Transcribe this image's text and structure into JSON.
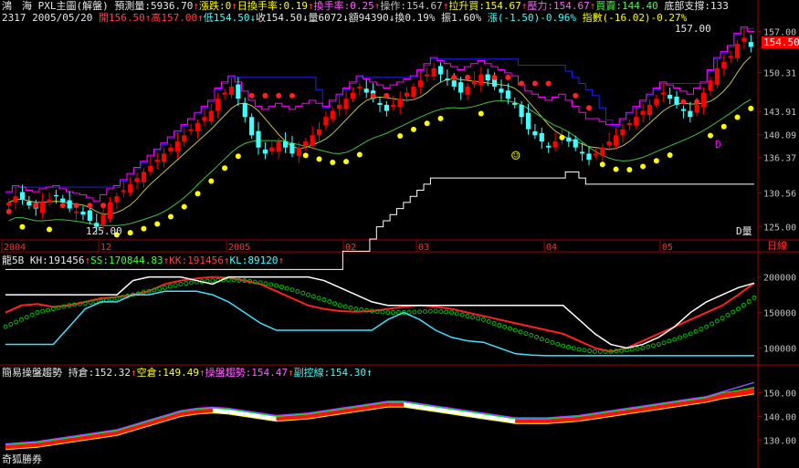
{
  "header": {
    "stock_name": "鴻　海",
    "chart_title": "PXL主圖(解盤)",
    "forecast_label": "預測量:",
    "forecast_value": "5936.70",
    "limit_down_label": "漲跌:",
    "limit_down_value": "0",
    "daily_turnover_label": "日換手率:",
    "daily_turnover_value": "0.19",
    "turnover_label": "換手率:",
    "turnover_value": "0.25",
    "operation_label": "操作:",
    "operation_value": "154.67",
    "pullup_label": "拉升買:",
    "pullup_value": "154.67",
    "pressure_label": "壓力:",
    "pressure_value": "154.67",
    "buy_label": "買賣:",
    "buy_value": "144.40",
    "support_label": "底部支撐:",
    "support_value": "133",
    "code": "2317",
    "date": "2005/05/20",
    "open_label": "開",
    "open_value": "156.50",
    "high_label": "高",
    "high_value": "157.00",
    "low_label": "低",
    "low_value": "154.50",
    "close_label": "收",
    "close_value": "154.50",
    "volume_label": "量",
    "volume_value": "6072",
    "amount_label": "額",
    "amount_value": "94390",
    "turnover2_label": "換",
    "turnover2_value": "0.19%",
    "amplitude_label": "振",
    "amplitude_value": "1.60%",
    "change_label": "漲",
    "change_value": "(-1.50)-0.96%",
    "index_label": "指數",
    "index_value": "(-16.02)-0.27%"
  },
  "colors": {
    "up": "#ff0000",
    "down": "#40ffff",
    "ma_blue": "#2020ff",
    "ma_magenta": "#ff00ff",
    "ma_green": "#40c040",
    "ma_olive": "#c0c040",
    "dot_yellow": "#ffff00",
    "dot_red": "#ff2020",
    "axis": "#a00000",
    "axis_text": "#c0c0c0",
    "date_text": "#ff3030",
    "kd_white": "#ffffff",
    "kd_green": "#00c000"
  },
  "main_panel": {
    "price_ticks": [
      "157.00",
      "150.31",
      "143.91",
      "140.09",
      "136.37",
      "130.56",
      "125.00"
    ],
    "current_price_tag": "154.50",
    "high_annotation": "157.00",
    "low_annotation": "125.00",
    "d_marker": "D",
    "volume_toggle": "D量",
    "date_labels": [
      "2004",
      "12",
      "2005",
      "02",
      "03",
      "04",
      "05"
    ],
    "period_label": "日線",
    "smiley": "☺"
  },
  "panel_kd": {
    "title": "龍5B",
    "kh_label": "KH:",
    "kh_value": "191456",
    "ss_label": "SS:",
    "ss_value": "170844.83",
    "kk_label": "KK:",
    "kk_value": "191456",
    "kl_label": "KL:",
    "kl_value": "89120",
    "ticks": [
      "200000",
      "150000",
      "100000"
    ]
  },
  "panel_trend": {
    "title": "簡易操盤趨勢",
    "hold_label": "持倉:",
    "hold_value": "152.32",
    "short_label": "空倉:",
    "short_value": "149.49",
    "trend_label": "操盤趨勢:",
    "trend_value": "154.47",
    "sub_label": "副控線:",
    "sub_value": "154.30",
    "ticks": [
      "150.00",
      "140.00",
      "130.00"
    ],
    "footer": "奇狐勝券"
  },
  "chart_data": [
    {
      "type": "candlestick",
      "title": "PXL主圖(解盤)",
      "ylim": [
        123,
        158
      ],
      "x_months": [
        "2004-11",
        "2004-12",
        "2005-01",
        "2005-02",
        "2005-03",
        "2005-04",
        "2005-05"
      ],
      "close_series": [
        129,
        130,
        129.5,
        128.5,
        128,
        129,
        129.5,
        130,
        129,
        128,
        127.5,
        127,
        126,
        125,
        127,
        129,
        130,
        131,
        132,
        133,
        134,
        135,
        136,
        137,
        138,
        139,
        140,
        141,
        142,
        143,
        144,
        146,
        147,
        148,
        146,
        143,
        140,
        138,
        137,
        138,
        139,
        138,
        137,
        138,
        139,
        140,
        141,
        143,
        144,
        145,
        146,
        147,
        148,
        147,
        146,
        145,
        144,
        145,
        146,
        147,
        148,
        149,
        150,
        151,
        150,
        149,
        148,
        147,
        148,
        149,
        150,
        149,
        148,
        147,
        146,
        145,
        143,
        141,
        140,
        139,
        138,
        139,
        140,
        139,
        138,
        137,
        136,
        137,
        138,
        139,
        140,
        141,
        142,
        143,
        144,
        145,
        146,
        147,
        146,
        145,
        144,
        143,
        145,
        147,
        149,
        151,
        152,
        153,
        155,
        156,
        154.5
      ],
      "last": {
        "open": 156.5,
        "high": 157.0,
        "low": 154.5,
        "close": 154.5
      }
    },
    {
      "type": "line",
      "title": "龍5B",
      "ylim": [
        80000,
        215000
      ],
      "series": [
        {
          "name": "KH",
          "values": [
            150000,
            160000,
            162000,
            158000,
            160000,
            165000,
            170000,
            172000,
            175000,
            180000,
            190000,
            195000,
            198000,
            200000,
            199000,
            195000,
            190000,
            180000,
            170000,
            160000,
            155000,
            152000,
            151000,
            152000,
            155000,
            158000,
            160000,
            158000,
            155000,
            150000,
            145000,
            140000,
            135000,
            130000,
            125000,
            120000,
            110000,
            100000,
            95000,
            100000,
            110000,
            120000,
            130000,
            140000,
            150000,
            160000,
            175000,
            191456
          ]
        },
        {
          "name": "SS",
          "values": [
            130000,
            140000,
            150000,
            155000,
            160000,
            163000,
            166000,
            170000,
            175000,
            180000,
            185000,
            190000,
            193000,
            195000,
            196000,
            195000,
            192000,
            188000,
            182000,
            175000,
            168000,
            160000,
            155000,
            152000,
            150000,
            150000,
            151000,
            152000,
            150000,
            145000,
            140000,
            132000,
            125000,
            118000,
            110000,
            103000,
            98000,
            95000,
            95000,
            97000,
            100000,
            105000,
            112000,
            120000,
            130000,
            142000,
            155000,
            170844.83
          ]
        },
        {
          "name": "KL",
          "values": [
            105000,
            105000,
            105000,
            105000,
            130000,
            155000,
            165000,
            165000,
            175000,
            175000,
            180000,
            180000,
            180000,
            175000,
            165000,
            150000,
            135000,
            125000,
            125000,
            125000,
            125000,
            125000,
            125000,
            125000,
            140000,
            150000,
            140000,
            125000,
            115000,
            110000,
            108000,
            100000,
            92000,
            90000,
            89120,
            89120,
            89120,
            89120,
            89120,
            89120,
            89120,
            89120,
            89120,
            89120,
            89120,
            89120,
            89120,
            89120
          ]
        },
        {
          "name": "KK",
          "values": [
            175000,
            175000,
            175000,
            175000,
            175000,
            175000,
            175000,
            175000,
            195000,
            200000,
            200000,
            200000,
            195000,
            190000,
            200000,
            200000,
            200000,
            200000,
            200000,
            200000,
            195000,
            185000,
            175000,
            165000,
            160000,
            160000,
            160000,
            160000,
            160000,
            160000,
            160000,
            160000,
            160000,
            160000,
            160000,
            160000,
            140000,
            120000,
            105000,
            100000,
            105000,
            115000,
            130000,
            150000,
            165000,
            175000,
            185000,
            191456
          ]
        }
      ]
    },
    {
      "type": "line",
      "title": "簡易操盤趨勢",
      "ylim": [
        124,
        156
      ],
      "series": [
        {
          "name": "持倉",
          "values": [
            128,
            128.5,
            129,
            130,
            131,
            132,
            133,
            134,
            136,
            138,
            140,
            142,
            143,
            143.5,
            143,
            142,
            141,
            140,
            140.5,
            141,
            142,
            143,
            144,
            145,
            146,
            146,
            145,
            144,
            143,
            142,
            141,
            140,
            139,
            139,
            139,
            139.5,
            140,
            141,
            142,
            143,
            144,
            145,
            146,
            147,
            148,
            150,
            151,
            152.32
          ]
        },
        {
          "name": "空倉",
          "values": [
            126,
            126.5,
            127,
            128,
            129,
            130,
            131,
            132,
            134,
            136,
            138,
            140,
            141,
            141.5,
            141,
            140,
            139,
            138,
            138.5,
            139,
            140,
            141,
            142,
            143,
            144,
            144,
            143,
            142,
            141,
            140,
            139,
            138,
            137,
            137,
            137,
            137.5,
            138,
            139,
            140,
            141,
            142,
            143,
            144,
            145,
            146,
            147.5,
            148.5,
            149.49
          ]
        },
        {
          "name": "操盤趨勢",
          "values": [
            128.5,
            129,
            129.5,
            130.5,
            131.5,
            132.5,
            133.5,
            134.5,
            136.5,
            138.5,
            140.5,
            142.5,
            143.5,
            144,
            143.5,
            142.5,
            141.5,
            140.5,
            141,
            141.5,
            142.5,
            143.5,
            144.5,
            145.5,
            146.5,
            146.5,
            145.5,
            144.5,
            143.5,
            142.5,
            141.5,
            140.5,
            139.5,
            139.5,
            139.5,
            140,
            140.5,
            141.5,
            142.5,
            143.5,
            144.5,
            145.5,
            146.5,
            147.5,
            148.5,
            150.5,
            152.5,
            154.47
          ]
        },
        {
          "name": "副控線",
          "values": [
            128.3,
            128.8,
            129.3,
            130.3,
            131.3,
            132.3,
            133.3,
            134.3,
            136.3,
            138.3,
            140.3,
            142.3,
            143.3,
            143.8,
            143.3,
            142.3,
            141.3,
            140.3,
            140.8,
            141.3,
            142.3,
            143.3,
            144.3,
            145.3,
            146.3,
            146.3,
            145.3,
            144.3,
            143.3,
            142.3,
            141.3,
            140.3,
            139.3,
            139.3,
            139.3,
            139.8,
            140.3,
            141.3,
            142.3,
            143.3,
            144.3,
            145.3,
            146.3,
            147.3,
            148.3,
            150.3,
            152.3,
            154.3
          ]
        }
      ]
    }
  ]
}
